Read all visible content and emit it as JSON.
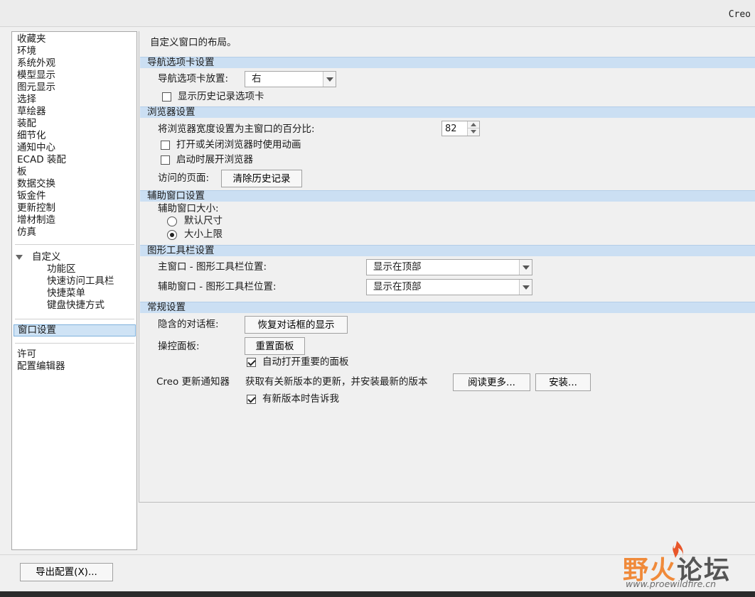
{
  "app_title": "Creo",
  "sidebar": {
    "group1": [
      "收藏夹",
      "环境",
      "系统外观",
      "模型显示",
      "图元显示",
      "选择",
      "草绘器",
      "装配",
      "细节化",
      "通知中心",
      "ECAD 装配",
      "板",
      "数据交换",
      "钣金件",
      "更新控制",
      "增材制造",
      "仿真"
    ],
    "customize": {
      "label": "自定义",
      "children": [
        "功能区",
        "快速访问工具栏",
        "快捷菜单",
        "键盘快捷方式"
      ]
    },
    "selected": "窗口设置",
    "group3": [
      "许可",
      "配置编辑器"
    ]
  },
  "main": {
    "description": "自定义窗口的布局。",
    "nav_section": {
      "header": "导航选项卡设置",
      "placement_label": "导航选项卡放置:",
      "placement_value": "右",
      "show_history_label": "显示历史记录选项卡",
      "show_history_checked": false
    },
    "browser_section": {
      "header": "浏览器设置",
      "width_label": "将浏览器宽度设置为主窗口的百分比:",
      "width_value": "82",
      "animate_label": "打开或关闭浏览器时使用动画",
      "animate_checked": false,
      "expand_label": "启动时展开浏览器",
      "expand_checked": false,
      "visited_label": "访问的页面:",
      "clear_history_button": "清除历史记录"
    },
    "aux_section": {
      "header": "辅助窗口设置",
      "size_label": "辅助窗口大小:",
      "default_size_label": "默认尺寸",
      "default_size_selected": false,
      "max_size_label": "大小上限",
      "max_size_selected": true
    },
    "graphics_section": {
      "header": "图形工具栏设置",
      "main_label": "主窗口 - 图形工具栏位置:",
      "main_value": "显示在顶部",
      "aux_label": "辅助窗口 - 图形工具栏位置:",
      "aux_value": "显示在顶部"
    },
    "general_section": {
      "header": "常规设置",
      "hidden_dialogs_label": "隐含的对话框:",
      "restore_dialogs_button": "恢复对话框的显示",
      "dashboard_label": "操控面板:",
      "reset_dashboard_button": "重置面板",
      "auto_open_label": "自动打开重要的面板",
      "auto_open_checked": true,
      "notifier_label": "Creo 更新通知器",
      "notifier_desc": "获取有关新版本的更新，并安装最新的版本",
      "read_more_button": "阅读更多...",
      "install_button": "安装...",
      "notify_label": "有新版本时告诉我",
      "notify_checked": true
    }
  },
  "footer": {
    "export_button": "导出配置(X)..."
  },
  "watermark": {
    "text_orange": "野火",
    "text_dark": "论坛",
    "url": "www.proewildfire.cn"
  }
}
